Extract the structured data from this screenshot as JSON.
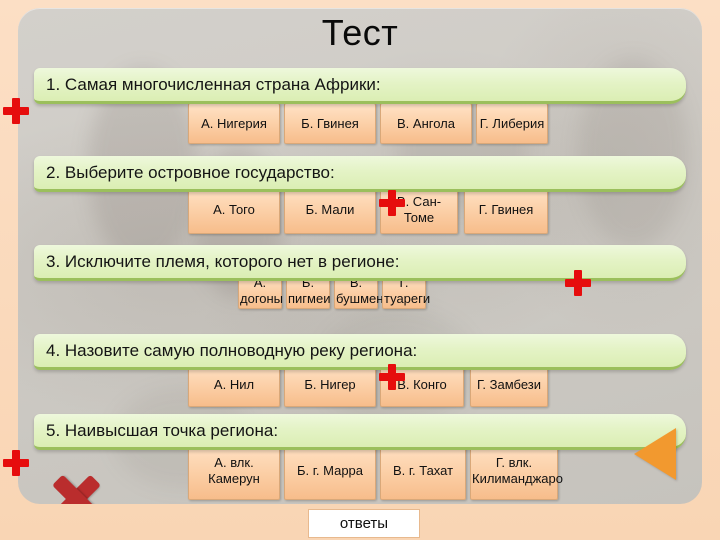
{
  "slide": {
    "title": "Тест",
    "answers_button": "ответы",
    "back_icon": "triangle-left-icon",
    "x_icon": "x-mark-icon",
    "plus_icon": "red-plus-icon",
    "colors": {
      "background": "#fbdcc0",
      "panel": "#cfccc6",
      "question_bar": "#e4f3c6",
      "question_bar_border": "#9bbf5c",
      "option": "#fcd2ab",
      "option_border": "#d9a879",
      "accent_red": "#e60d0d",
      "x_red": "#ba2d2d",
      "orange": "#f2992f"
    }
  },
  "questions": [
    {
      "number": "1",
      "text": "1. Самая многочисленная страна Африки:",
      "options": [
        {
          "label": "А. Нигерия"
        },
        {
          "label": "Б. Гвинея"
        },
        {
          "label": "В. Ангола"
        },
        {
          "label": "Г. Либерия"
        }
      ]
    },
    {
      "number": "2",
      "text": "2. Выберите островное государство:",
      "options": [
        {
          "label": "А.  Того"
        },
        {
          "label": "Б. Мали"
        },
        {
          "label": "В. Сан-Томе"
        },
        {
          "label": "Г. Гвинея"
        }
      ]
    },
    {
      "number": "3",
      "text": "3. Исключите племя, которого нет в регионе:",
      "options": [
        {
          "label": "А. догоны"
        },
        {
          "label": "Б. пигмеи"
        },
        {
          "label": "В. бушмены"
        },
        {
          "label": "Г. туареги"
        }
      ]
    },
    {
      "number": "4",
      "text": "4. Назовите самую полноводную реку региона:",
      "options": [
        {
          "label": "А. Нил"
        },
        {
          "label": "Б. Нигер"
        },
        {
          "label": "В. Конго"
        },
        {
          "label": "Г. Замбези"
        }
      ]
    },
    {
      "number": "5",
      "text": "5. Наивысшая точка региона:",
      "options": [
        {
          "label": "А. влк. Камерун"
        },
        {
          "label": "Б. г. Марра"
        },
        {
          "label": "В. г. Тахат"
        },
        {
          "label": "Г. влк. Килиманджаро"
        }
      ]
    }
  ]
}
